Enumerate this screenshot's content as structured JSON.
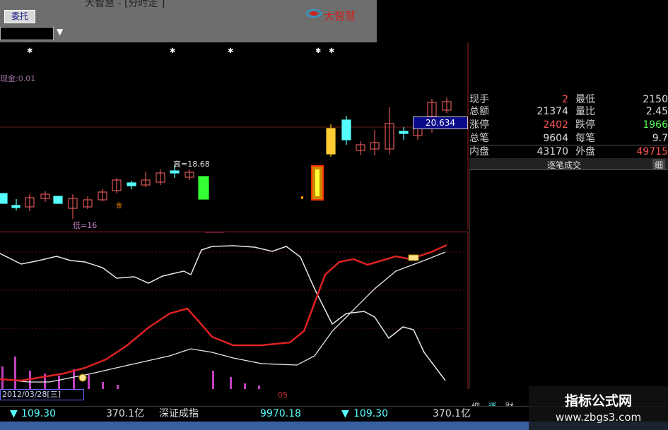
{
  "titlebar": {
    "text": "大智慧 - [分时走 ]",
    "wt_button": "委托",
    "brand": "大智慧"
  },
  "kline": {
    "mode_label": "现金:0.01",
    "high_label": "高=18.68",
    "low_label": "低=16",
    "current_price_tag": "20.634",
    "event_mark": "金"
  },
  "info_panel": {
    "rows": [
      {
        "l1": "现手",
        "v1": "2",
        "l2": "最低",
        "v2": "2150"
      },
      {
        "l1": "总额",
        "v1": "21374",
        "l2": "量比",
        "v2": "2.45"
      },
      {
        "l1": "涨停",
        "v1": "2402",
        "l2": "跌停",
        "v2": "1966"
      },
      {
        "l1": "总笔",
        "v1": "9604",
        "l2": "每笔",
        "v2": "9.7"
      }
    ],
    "neipan_label": "内盘",
    "neipan_value": "43170",
    "waipan_label": "外盘",
    "waipan_value": "49715",
    "tick_title": "逐笔成交",
    "tick_button": "细",
    "colors": {
      "red": "#ff5050",
      "white": "#ffffff"
    }
  },
  "bottom": {
    "date": "2012/03/28[三]",
    "red_mark": "05",
    "tabs": [
      "细",
      "逐",
      "财"
    ]
  },
  "ticker": {
    "arrow1": "▼",
    "value1": "109.30",
    "amount1": "370.1亿",
    "index_name": "深证成指",
    "index_value": "9970.18",
    "arrow2": "▼",
    "value2": "109.30",
    "amount2": "370.1亿"
  },
  "watermark": {
    "line1": "指标公式网",
    "line2": "www.zbgs3.com"
  }
}
